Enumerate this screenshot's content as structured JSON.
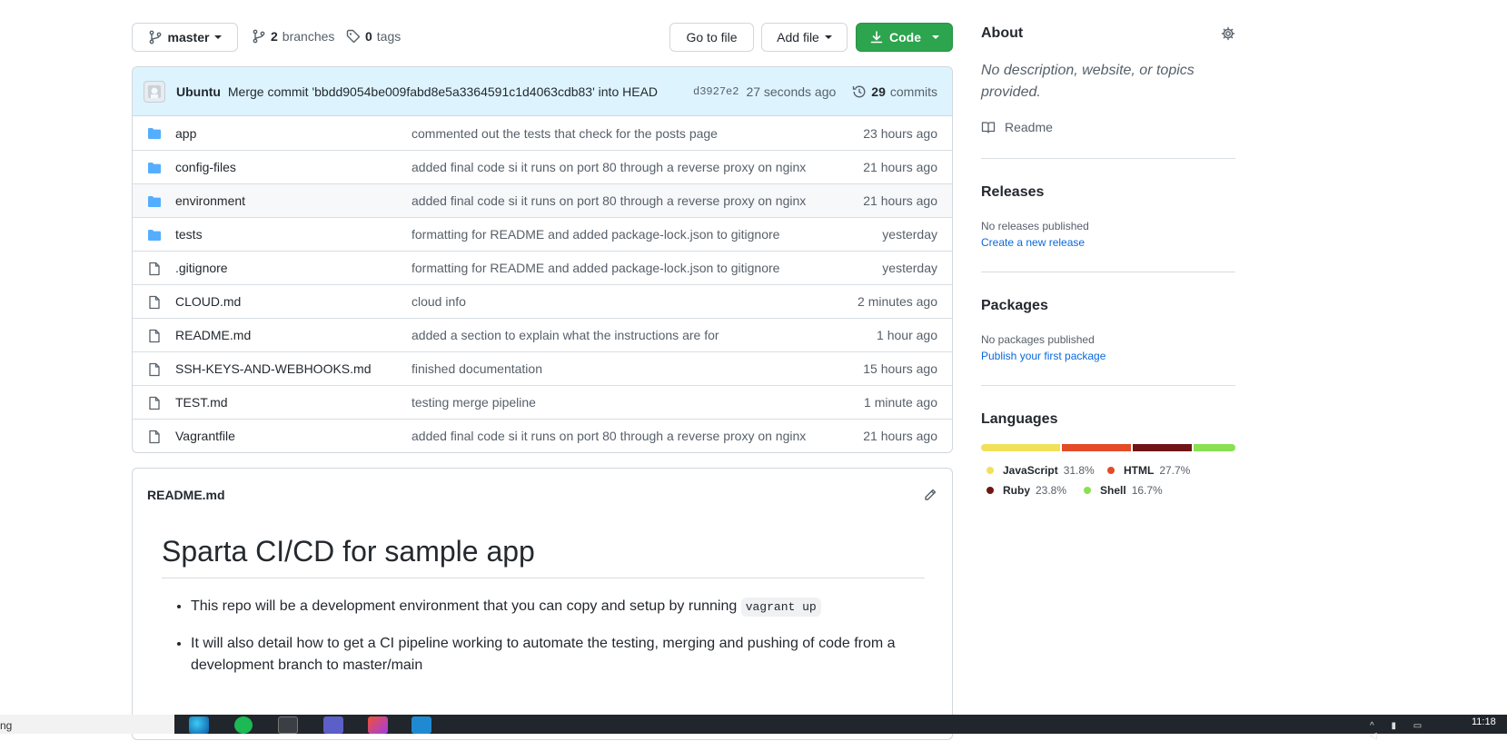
{
  "toolbar": {
    "branch_label": "master",
    "branches_count": "2",
    "branches_label": "branches",
    "tags_count": "0",
    "tags_label": "tags",
    "go_to_file": "Go to file",
    "add_file": "Add file",
    "code": "Code"
  },
  "commit": {
    "author": "Ubuntu",
    "message": "Merge commit 'bbdd9054be009fabd8e5a3364591c1d4063cdb83' into HEAD",
    "sha": "d3927e2",
    "time": "27 seconds ago",
    "count": "29",
    "count_label": "commits"
  },
  "files": [
    {
      "type": "dir",
      "name": "app",
      "message": "commented out the tests that check for the posts page",
      "age": "23 hours ago"
    },
    {
      "type": "dir",
      "name": "config-files",
      "message": "added final code si it runs on port 80 through a reverse proxy on nginx",
      "age": "21 hours ago"
    },
    {
      "type": "dir",
      "name": "environment",
      "message": "added final code si it runs on port 80 through a reverse proxy on nginx",
      "age": "21 hours ago"
    },
    {
      "type": "dir",
      "name": "tests",
      "message": "formatting for README and added package-lock.json to gitignore",
      "age": "yesterday"
    },
    {
      "type": "file",
      "name": ".gitignore",
      "message": "formatting for README and added package-lock.json to gitignore",
      "age": "yesterday"
    },
    {
      "type": "file",
      "name": "CLOUD.md",
      "message": "cloud info",
      "age": "2 minutes ago"
    },
    {
      "type": "file",
      "name": "README.md",
      "message": "added a section to explain what the instructions are for",
      "age": "1 hour ago"
    },
    {
      "type": "file",
      "name": "SSH-KEYS-AND-WEBHOOKS.md",
      "message": "finished documentation",
      "age": "15 hours ago"
    },
    {
      "type": "file",
      "name": "TEST.md",
      "message": "testing merge pipeline",
      "age": "1 minute ago"
    },
    {
      "type": "file",
      "name": "Vagrantfile",
      "message": "added final code si it runs on port 80 through a reverse proxy on nginx",
      "age": "21 hours ago"
    }
  ],
  "readme": {
    "filename": "README.md",
    "title": "Sparta CI/CD for sample app",
    "bullet1_text": "This repo will be a development environment that you can copy and setup by running ",
    "bullet1_code": "vagrant up",
    "bullet2": "It will also detail how to get a CI pipeline working to automate the testing, merging and pushing of code from a development branch to master/main"
  },
  "about": {
    "title": "About",
    "description": "No description, website, or topics provided.",
    "readme_link": "Readme"
  },
  "releases": {
    "title": "Releases",
    "none": "No releases published",
    "create_link": "Create a new release"
  },
  "packages": {
    "title": "Packages",
    "none": "No packages published",
    "publish_link": "Publish your first package"
  },
  "languages": {
    "title": "Languages",
    "items": [
      {
        "name": "JavaScript",
        "percent": "31.8%",
        "color": "#f1e05a"
      },
      {
        "name": "HTML",
        "percent": "27.7%",
        "color": "#e34c26"
      },
      {
        "name": "Ruby",
        "percent": "23.8%",
        "color": "#701516"
      },
      {
        "name": "Shell",
        "percent": "16.7%",
        "color": "#89e051"
      }
    ]
  },
  "taskbar": {
    "left_text": "ng",
    "clock": "11:18"
  }
}
